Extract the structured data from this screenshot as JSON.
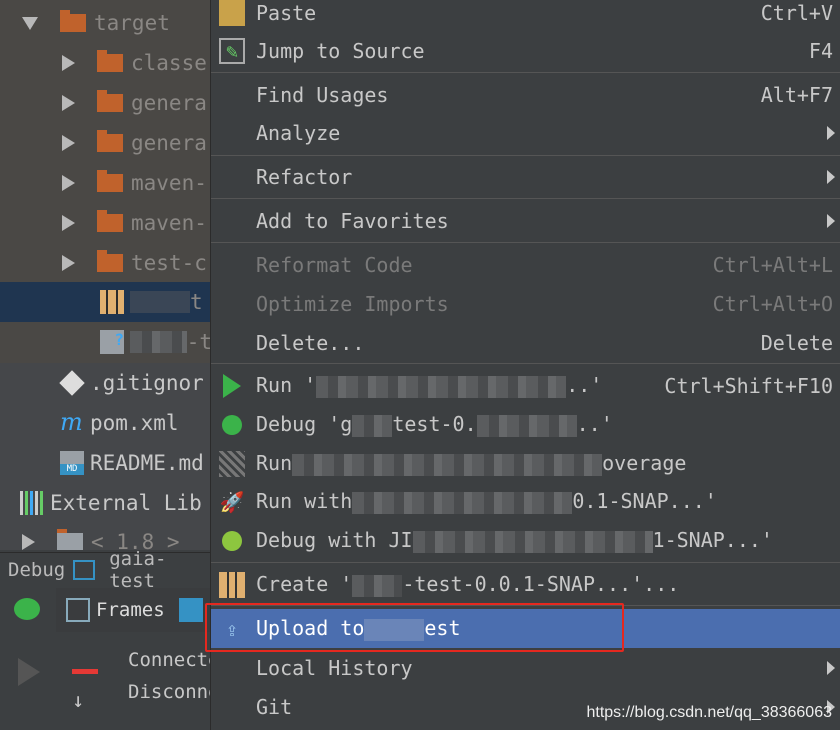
{
  "tree": {
    "items": [
      {
        "label": "target",
        "type": "folder",
        "expanded": true
      },
      {
        "label": "classe",
        "type": "folder"
      },
      {
        "label": "genera",
        "type": "folder"
      },
      {
        "label": "genera",
        "type": "folder"
      },
      {
        "label": "maven-",
        "type": "folder"
      },
      {
        "label": "maven-",
        "type": "folder"
      },
      {
        "label": "test-c",
        "type": "folder"
      },
      {
        "label": "t",
        "type": "jar",
        "selected": true
      },
      {
        "label": "-t",
        "type": "unknown-file"
      },
      {
        "label": ".gitignor",
        "type": "git"
      },
      {
        "label": "pom.xml",
        "type": "maven"
      },
      {
        "label": "README.md",
        "type": "markdown"
      },
      {
        "label": "External Lib",
        "type": "libraries"
      },
      {
        "label": "< 1.8 >",
        "type": "jdk"
      }
    ]
  },
  "debug": {
    "tab_label": "Debug",
    "config": "gaia-test",
    "frames_label": "Frames",
    "console": [
      "Connecte",
      "Disconne"
    ]
  },
  "menu": {
    "items": [
      {
        "label": "Paste",
        "shortcut": "Ctrl+V",
        "icon": "paste-icon"
      },
      {
        "label": "Jump to Source",
        "shortcut": "F4",
        "icon": "edit-icon"
      },
      {
        "label": "Find Usages",
        "shortcut": "Alt+F7"
      },
      {
        "label": "Analyze",
        "submenu": true
      },
      {
        "label": "Refactor",
        "submenu": true
      },
      {
        "label": "Add to Favorites",
        "submenu": true
      },
      {
        "label": "Reformat Code",
        "shortcut": "Ctrl+Alt+L",
        "disabled": true
      },
      {
        "label": "Optimize Imports",
        "shortcut": "Ctrl+Alt+O",
        "disabled": true
      },
      {
        "label": "Delete...",
        "shortcut": "Delete"
      },
      {
        "label": "Run '",
        "tail": "..'",
        "shortcut": "Ctrl+Shift+F10",
        "icon": "run-icon"
      },
      {
        "label": "Debug 'g",
        "tail": "test-0.",
        "tail2": "..'",
        "icon": "debug-icon"
      },
      {
        "label": "Run",
        "tail": "overage",
        "icon": "coverage-icon"
      },
      {
        "label": "Run with",
        "tail": "0.1-SNAP...'",
        "icon": "jrebel-run-icon"
      },
      {
        "label": "Debug with JI",
        "tail": "1-SNAP...'",
        "icon": "jrebel-debug-icon"
      },
      {
        "label": "Create '",
        "tail": "-test-0.0.1-SNAP...'...",
        "icon": "archive-icon"
      },
      {
        "label": "Upload to",
        "tail": "est",
        "icon": "upload-icon",
        "highlighted": true
      },
      {
        "label": "Local History",
        "submenu": true
      },
      {
        "label": "Git",
        "submenu": true
      }
    ]
  },
  "watermark": "https://blog.csdn.net/qq_38366063",
  "colors": {
    "highlight": "#4b6eaf",
    "annotation": "#e5281f",
    "folder": "#c0622c"
  }
}
